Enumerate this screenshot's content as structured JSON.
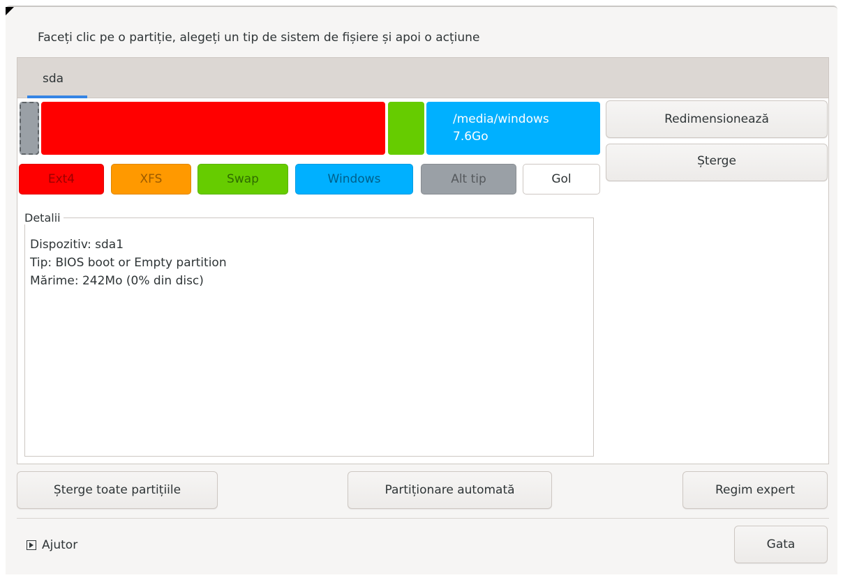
{
  "instruction": "Faceți clic pe o partiție, alegeți un tip de sistem de fișiere și apoi o acțiune",
  "tabs": [
    {
      "label": "sda",
      "selected": true
    }
  ],
  "partitions": [
    {
      "name": "sda1",
      "color": "#9aa0a6",
      "selected": true
    },
    {
      "name": "ext4",
      "color": "#ff0000"
    },
    {
      "name": "swap",
      "color": "#66cc00"
    },
    {
      "name": "windows",
      "color": "#00b0ff",
      "mount": "/media/windows",
      "size": "7.6Go"
    }
  ],
  "legend": [
    {
      "label": "Ext4",
      "color": "#ff0000",
      "text_color": "#9a0000"
    },
    {
      "label": "XFS",
      "color": "#ff9900",
      "text_color": "#9a5a00"
    },
    {
      "label": "Swap",
      "color": "#66cc00",
      "text_color": "#2f6b00"
    },
    {
      "label": "Windows",
      "color": "#00b0ff",
      "text_color": "#005f8a"
    },
    {
      "label": "Alt tip",
      "color": "#9aa0a6",
      "text_color": "#55595d"
    },
    {
      "label": "Gol",
      "color": "#ffffff",
      "text_color": "#2e3436"
    }
  ],
  "actions": {
    "resize": "Redimensionează",
    "delete": "Șterge"
  },
  "details": {
    "label": "Detalii",
    "device": "Dispozitiv: sda1",
    "type": "Tip: BIOS boot or Empty partition",
    "size": "Mărime: 242Mo (0% din disc)"
  },
  "bottom": {
    "clear_all": "Șterge toate partițiile",
    "auto": "Partiționare automată",
    "expert": "Regim expert"
  },
  "footer": {
    "help": "Ajutor",
    "done": "Gata"
  }
}
